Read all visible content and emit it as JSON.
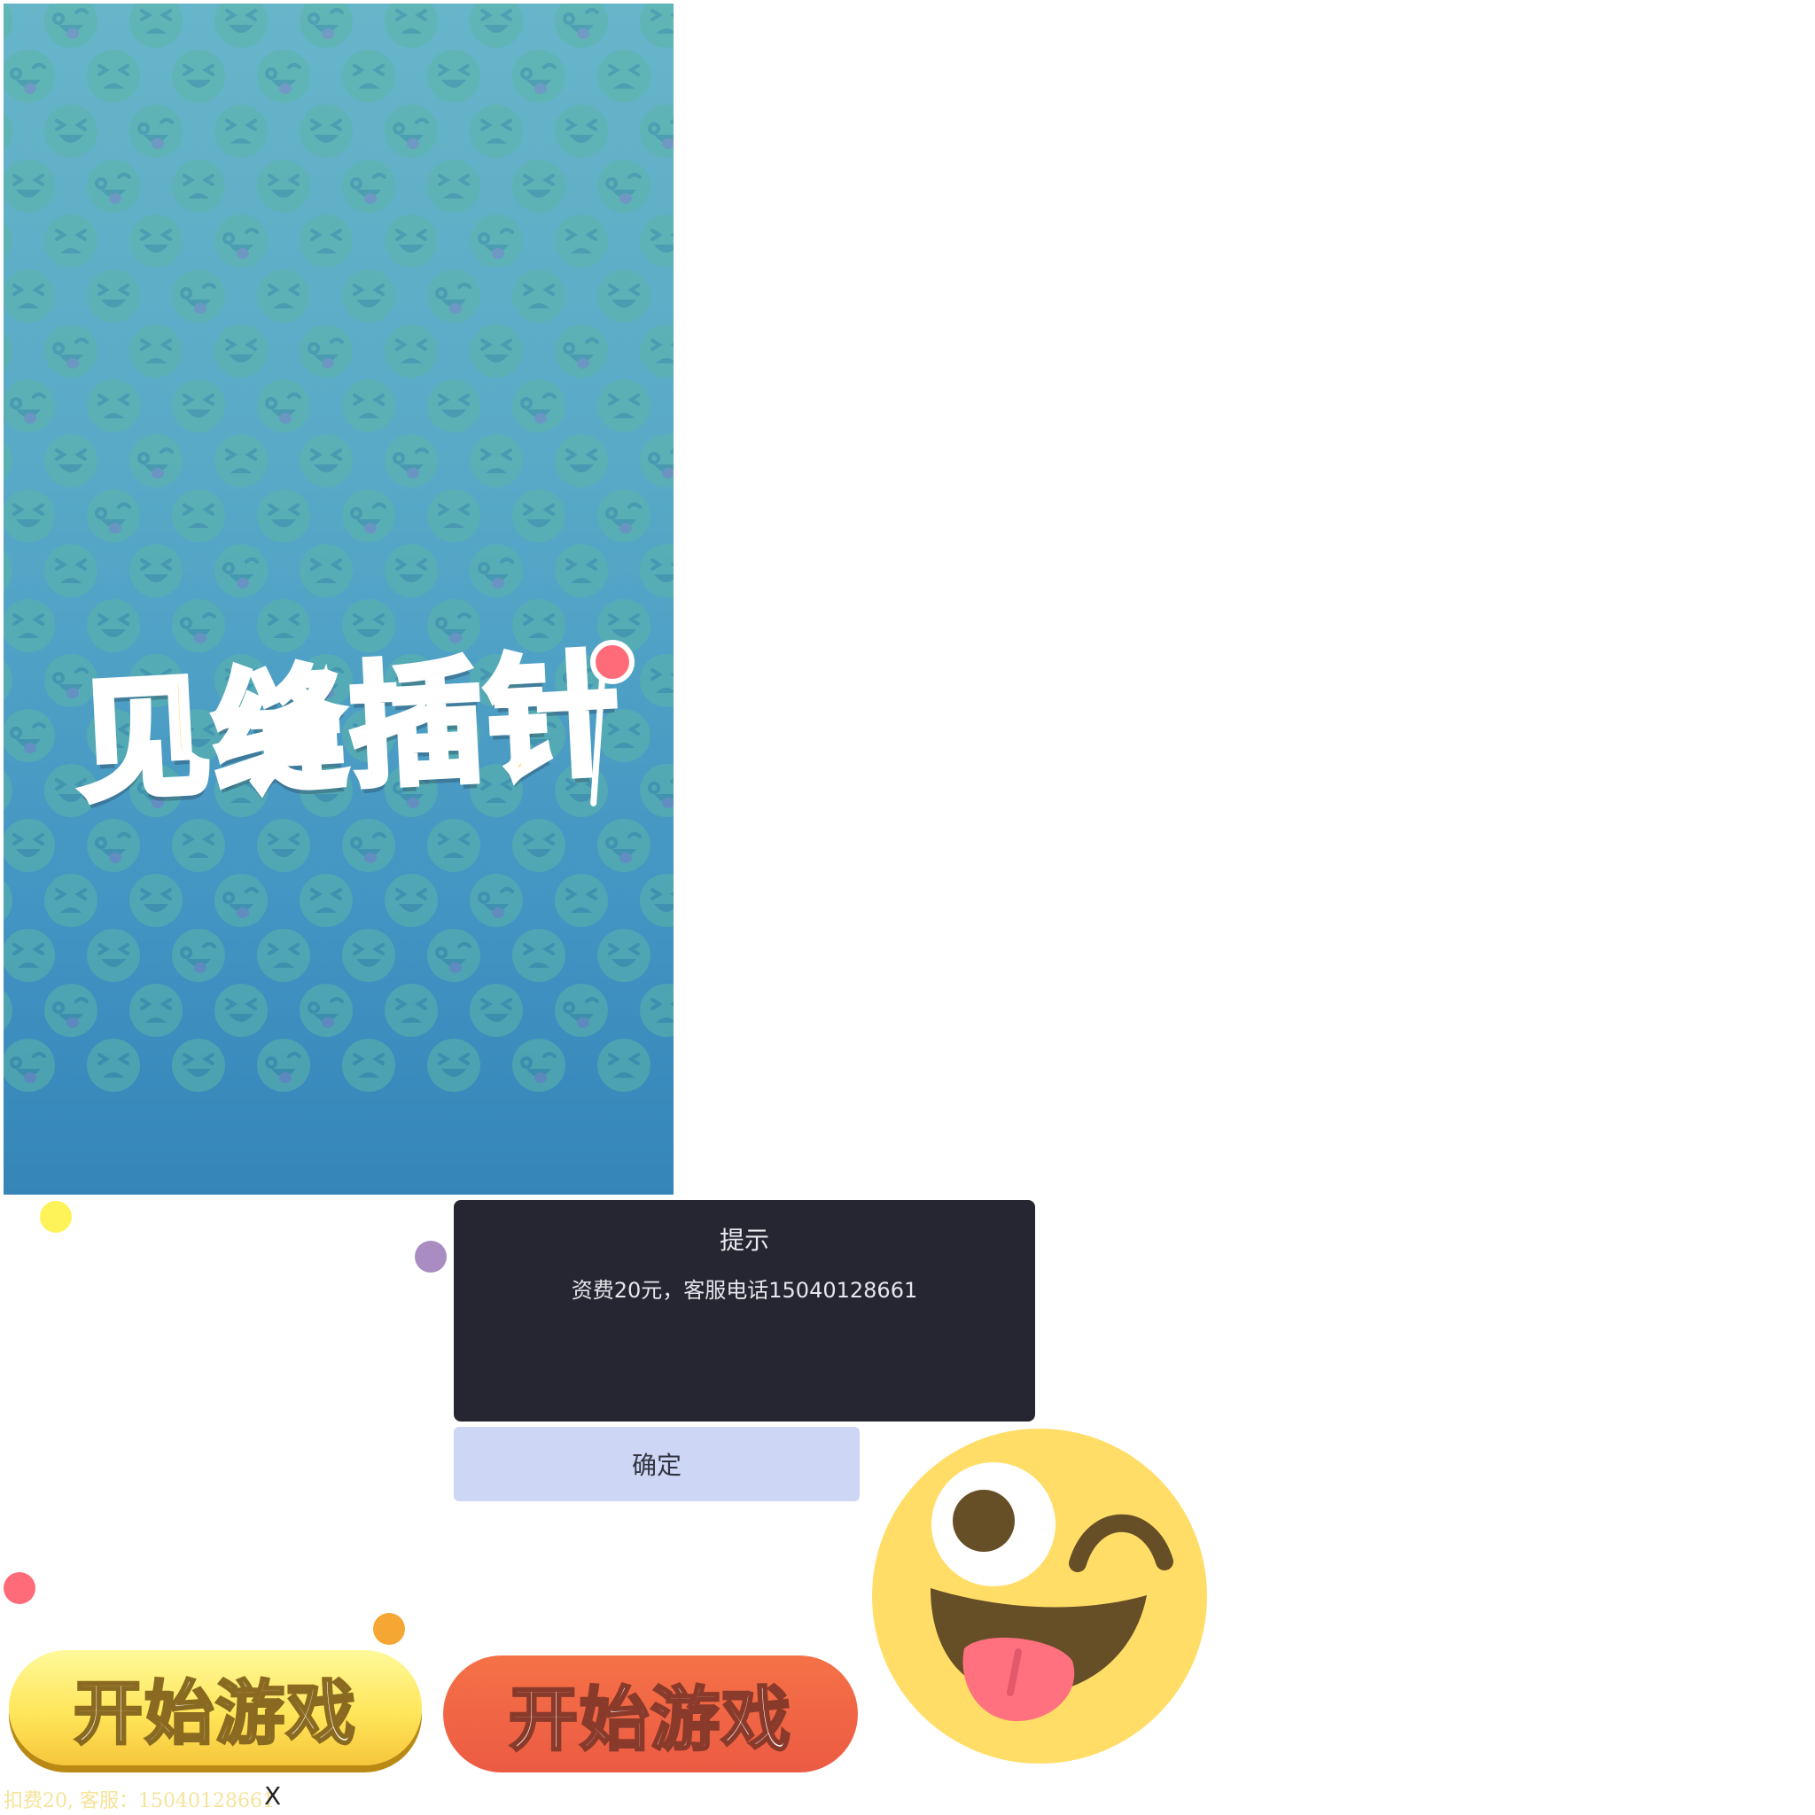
{
  "game": {
    "title": "见缝插针"
  },
  "dialog": {
    "title": "提示",
    "message": "资费20元，客服电话15040128661",
    "confirm_label": "确定"
  },
  "buttons": {
    "start_yellow_label": "开始游戏",
    "start_red_label": "开始游戏"
  },
  "footer": {
    "notice": "扣费20, 客服：15040128661",
    "close_label": "X"
  },
  "colors": {
    "splash_top": "#67b5c9",
    "splash_bottom": "#3585b9",
    "title_fill": "#ffdb6a",
    "dialog_bg": "#262632",
    "confirm_bg": "#cdd6f4",
    "start_yellow": "#ffe65a",
    "start_red": "#ec5b44",
    "emoji_face": "#ffdd67",
    "dot_yellow": "#fff35a",
    "dot_purple": "#a88cc2",
    "dot_red": "#ff6b78",
    "dot_orange": "#f5a633"
  },
  "icons": {
    "background_pattern": "emoji-pattern",
    "mascot": "winking-tongue-emoji-icon"
  }
}
